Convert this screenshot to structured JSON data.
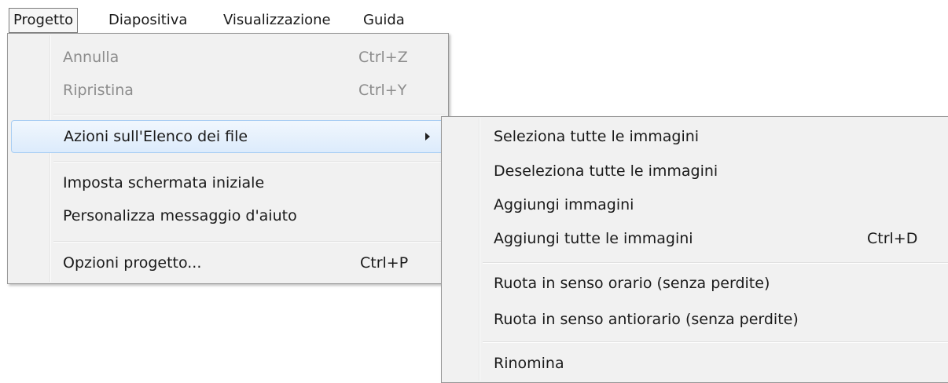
{
  "menubar": {
    "items": [
      {
        "label": "Progetto"
      },
      {
        "label": "Diapositiva"
      },
      {
        "label": "Visualizzazione"
      },
      {
        "label": "Guida"
      }
    ]
  },
  "main_menu": {
    "items": [
      {
        "label": "Annulla",
        "shortcut": "Ctrl+Z",
        "disabled": true
      },
      {
        "label": "Ripristina",
        "shortcut": "Ctrl+Y",
        "disabled": true
      },
      {
        "label": "Azioni sull'Elenco dei file",
        "has_submenu": true,
        "highlighted": true
      },
      {
        "label": "Imposta schermata iniziale"
      },
      {
        "label": "Personalizza messaggio d'aiuto"
      },
      {
        "label": "Opzioni progetto...",
        "shortcut": "Ctrl+P"
      }
    ]
  },
  "submenu": {
    "items": [
      {
        "label": "Seleziona tutte le immagini"
      },
      {
        "label": "Deseleziona tutte le immagini"
      },
      {
        "label": "Aggiungi immagini"
      },
      {
        "label": "Aggiungi tutte le immagini",
        "shortcut": "Ctrl+D"
      },
      {
        "label": "Ruota in senso orario (senza perdite)"
      },
      {
        "label": "Ruota in senso antiorario (senza perdite)"
      },
      {
        "label": "Rinomina"
      }
    ]
  },
  "icons": {
    "submenu_arrow": "chevron-right-icon"
  }
}
